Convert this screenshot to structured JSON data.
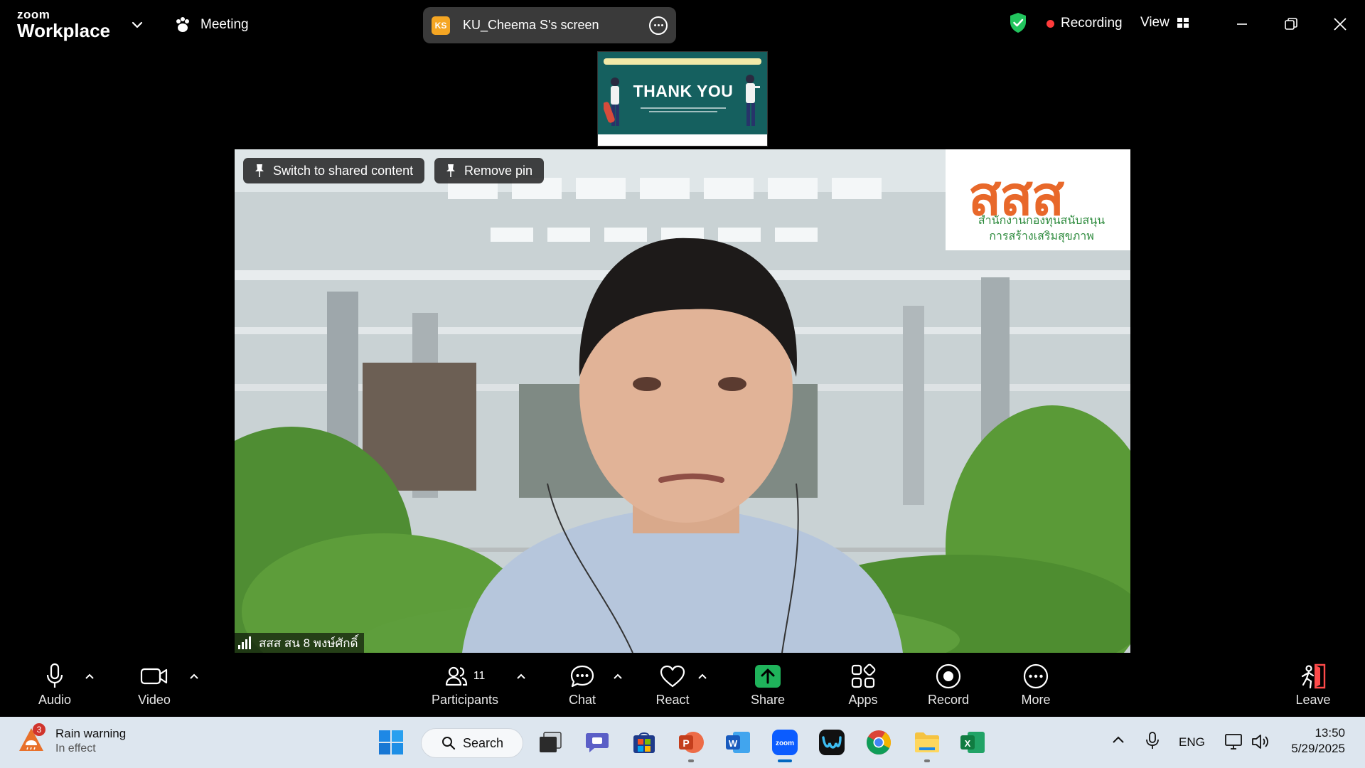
{
  "app": {
    "brand_top": "zoom",
    "brand_bottom": "Workplace"
  },
  "titlebar": {
    "meeting_label": "Meeting",
    "share_initials": "KS",
    "share_label": "KU_Cheema S's screen",
    "recording_label": "Recording",
    "view_label": "View"
  },
  "shared_thumbnail": {
    "headline": "THANK YOU"
  },
  "video": {
    "switch_label": "Switch to shared content",
    "remove_pin_label": "Remove pin",
    "participant_name": "สสส สน 8 พงษ์ศักดิ์",
    "logo_brand": "สสส",
    "logo_line1": "สำนักงานกองทุนสนับสนุน",
    "logo_line2": "การสร้างเสริมสุขภาพ"
  },
  "toolbar": {
    "audio": "Audio",
    "video": "Video",
    "participants": "Participants",
    "participants_count": "11",
    "chat": "Chat",
    "react": "React",
    "share": "Share",
    "apps": "Apps",
    "record": "Record",
    "more": "More",
    "leave": "Leave"
  },
  "taskbar": {
    "weather_badge": "3",
    "weather_title": "Rain warning",
    "weather_sub": "In effect",
    "search_label": "Search",
    "language": "ENG",
    "time": "13:50",
    "date": "5/29/2025"
  },
  "colors": {
    "share_green": "#1fb35b",
    "record_red": "#ff3b3b",
    "shield_green": "#22c55e",
    "zoom_blue": "#0b5cff",
    "taskbar_bg": "#dde6ef"
  }
}
